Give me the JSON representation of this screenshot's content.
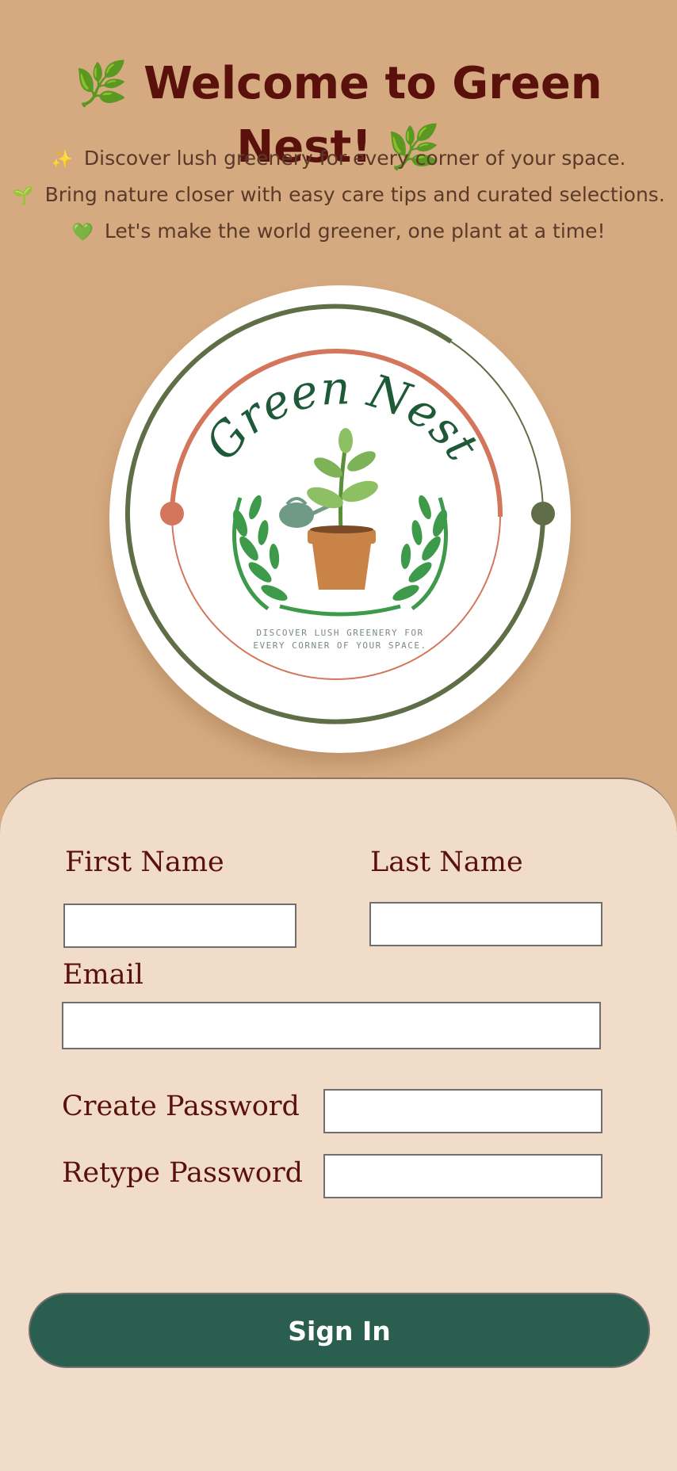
{
  "header": {
    "title": "Welcome to Green Nest!",
    "title_emoji": "🌿",
    "taglines": [
      {
        "emoji": "✨",
        "text": "Discover lush greenery for every corner of your space."
      },
      {
        "emoji": "🌱",
        "text": "Bring nature closer with easy care tips and curated selections."
      },
      {
        "emoji": "💚",
        "text": "Let's make the world greener, one plant at a time!"
      }
    ]
  },
  "logo": {
    "brand": "Green Nest",
    "motto_line1": "DISCOVER LUSH GREENERY FOR",
    "motto_line2": "EVERY CORNER OF YOUR SPACE."
  },
  "form": {
    "first_name_label": "First Name",
    "first_name_value": "",
    "last_name_label": "Last Name",
    "last_name_value": "",
    "email_label": "Email",
    "email_value": "",
    "create_password_label": "Create Password",
    "create_password_value": "",
    "retype_password_label": "Retype Password",
    "retype_password_value": "",
    "submit_label": "Sign In"
  },
  "colors": {
    "page_bg": "#d6aa80",
    "panel_bg": "#f0dcc9",
    "title": "#5a110c",
    "button": "#2a5e4e",
    "logo_green": "#1f5a38",
    "logo_terracotta": "#d4765c",
    "logo_olive": "#5f6e46"
  }
}
